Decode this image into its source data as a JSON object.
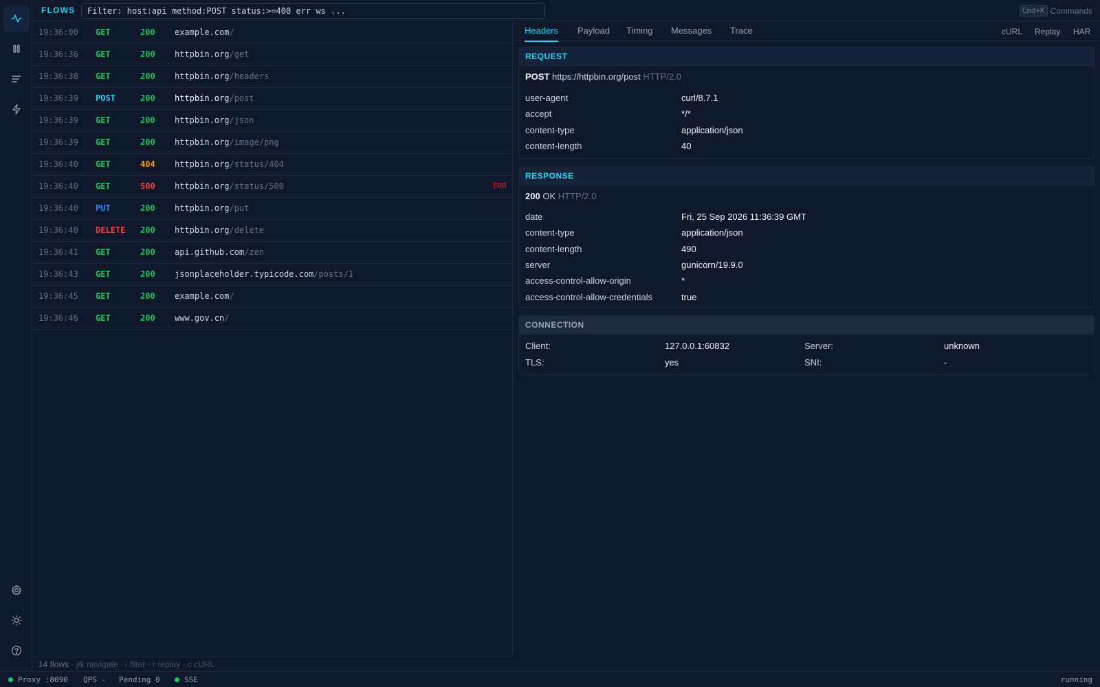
{
  "header": {
    "title": "FLOWS",
    "filter_placeholder": "Filter: host:api method:POST status:>=400 err ws ...",
    "shortcut_key": "Cmd+K",
    "commands_label": "Commands"
  },
  "sidebar": {
    "top_items": [
      {
        "name": "activity-icon",
        "active": true
      },
      {
        "name": "pause-icon",
        "active": false
      },
      {
        "name": "list-icon",
        "active": false
      },
      {
        "name": "bolt-icon",
        "active": false
      }
    ],
    "bottom_items": [
      {
        "name": "gear-icon"
      },
      {
        "name": "sun-icon"
      },
      {
        "name": "help-icon"
      }
    ]
  },
  "flows": [
    {
      "time": "19:36:00",
      "method": "GET",
      "status": "200",
      "host": "example.com",
      "path": "/",
      "err": ""
    },
    {
      "time": "19:36:36",
      "method": "GET",
      "status": "200",
      "host": "httpbin.org",
      "path": "/get",
      "err": ""
    },
    {
      "time": "19:36:38",
      "method": "GET",
      "status": "200",
      "host": "httpbin.org",
      "path": "/headers",
      "err": ""
    },
    {
      "time": "19:36:39",
      "method": "POST",
      "status": "200",
      "host": "httpbin.org",
      "path": "/post",
      "err": "",
      "selected": true
    },
    {
      "time": "19:36:39",
      "method": "GET",
      "status": "200",
      "host": "httpbin.org",
      "path": "/json",
      "err": ""
    },
    {
      "time": "19:36:39",
      "method": "GET",
      "status": "200",
      "host": "httpbin.org",
      "path": "/image/png",
      "err": ""
    },
    {
      "time": "19:36:40",
      "method": "GET",
      "status": "404",
      "host": "httpbin.org",
      "path": "/status/404",
      "err": ""
    },
    {
      "time": "19:36:40",
      "method": "GET",
      "status": "500",
      "host": "httpbin.org",
      "path": "/status/500",
      "err": "ERR"
    },
    {
      "time": "19:36:40",
      "method": "PUT",
      "status": "200",
      "host": "httpbin.org",
      "path": "/put",
      "err": ""
    },
    {
      "time": "19:36:40",
      "method": "DELETE",
      "status": "200",
      "host": "httpbin.org",
      "path": "/delete",
      "err": ""
    },
    {
      "time": "19:36:41",
      "method": "GET",
      "status": "200",
      "host": "api.github.com",
      "path": "/zen",
      "err": ""
    },
    {
      "time": "19:36:43",
      "method": "GET",
      "status": "200",
      "host": "jsonplaceholder.typicode.com",
      "path": "/posts/1",
      "err": ""
    },
    {
      "time": "19:36:45",
      "method": "GET",
      "status": "200",
      "host": "example.com",
      "path": "/",
      "err": ""
    },
    {
      "time": "19:36:46",
      "method": "GET",
      "status": "200",
      "host": "www.gov.cn",
      "path": "/",
      "err": ""
    }
  ],
  "flow_footer": {
    "count": "14 flows",
    "hints": " · j/k navigate · / filter · r replay · c cURL"
  },
  "tabs": [
    "Headers",
    "Payload",
    "Timing",
    "Messages",
    "Trace"
  ],
  "active_tab": "Headers",
  "actions": [
    "cURL",
    "Replay",
    "HAR"
  ],
  "request": {
    "title": "REQUEST",
    "method": "POST",
    "url": "https://httpbin.org/post",
    "protocol": "HTTP/2.0",
    "headers": [
      {
        "key": "user-agent",
        "value": "curl/8.7.1"
      },
      {
        "key": "accept",
        "value": "*/*"
      },
      {
        "key": "content-type",
        "value": "application/json"
      },
      {
        "key": "content-length",
        "value": "40"
      }
    ]
  },
  "response": {
    "title": "RESPONSE",
    "status": "200",
    "reason": "OK",
    "protocol": "HTTP/2.0",
    "headers": [
      {
        "key": "date",
        "value": "Fri, 25 Sep 2026 11:36:39 GMT"
      },
      {
        "key": "content-type",
        "value": "application/json"
      },
      {
        "key": "content-length",
        "value": "490"
      },
      {
        "key": "server",
        "value": "gunicorn/19.9.0"
      },
      {
        "key": "access-control-allow-origin",
        "value": "*"
      },
      {
        "key": "access-control-allow-credentials",
        "value": "true"
      }
    ]
  },
  "connection": {
    "title": "CONNECTION",
    "client_label": "Client:",
    "client_value": "127.0.0.1:60832",
    "server_label": "Server:",
    "server_value": "unknown",
    "tls_label": "TLS:",
    "tls_value": "yes",
    "sni_label": "SNI:",
    "sni_value": "-"
  },
  "statusbar": {
    "proxy": "Proxy :8090",
    "qps": "QPS -",
    "pending": "Pending 0",
    "sse": "SSE",
    "state": "running"
  },
  "colors": {
    "accent": "#22d3ee",
    "success": "#22c55e",
    "warning": "#f59e0b",
    "error": "#ef4444",
    "put": "#3b82f6"
  }
}
